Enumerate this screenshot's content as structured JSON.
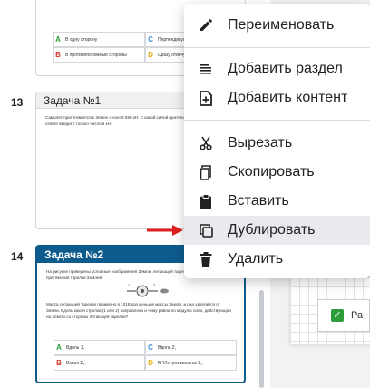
{
  "slides": [
    {
      "number": "",
      "title": "",
      "text": "",
      "options": [
        {
          "letter": "A",
          "text": "В одну сторону",
          "color": "green"
        },
        {
          "letter": "C",
          "text": "Перпендикулярно",
          "color": "blue"
        },
        {
          "letter": "B",
          "text": "В противоположные стороны",
          "color": "red"
        },
        {
          "letter": "D",
          "text": "Сразу отвечу",
          "color": "yellow"
        }
      ]
    },
    {
      "number": "13",
      "title": "Задача №1",
      "text": "Самолёт притягивается к Земле с силой 550 кН. С какой силой притягивается к самолёту? В ответе введите только число в кН."
    },
    {
      "number": "14",
      "title": "Задача №2",
      "text": "На рисунке приведены условные изображения Земли, летающей тарелки и вектора Fₑ силы притяжения тарелки Землей.",
      "text2": "Масса летающей тарелки примерно в 1018 раз меньше массы Земли, и она удаляется от Земли. Вдоль какой стрелки (1 или 2) направлена и чему равна по модулю сила, действующая на Землю со стороны летающей тарелки?",
      "diagram_labels": [
        "1",
        "2"
      ],
      "options": [
        {
          "letter": "A",
          "text": "Вдоль 1,",
          "color": "green"
        },
        {
          "letter": "C",
          "text": "Вдоль 2,",
          "color": "blue"
        },
        {
          "letter": "B",
          "text": "Равна Fₑ,",
          "color": "red"
        },
        {
          "letter": "D",
          "text": "В 10¹⁸ раз меньше Fₑ,",
          "color": "yellow"
        }
      ]
    }
  ],
  "canvas": {
    "row_text": "Ра"
  },
  "menu": {
    "items": [
      {
        "label": "Переименовать",
        "icon": "pencil-icon"
      },
      {
        "label": "Добавить раздел",
        "icon": "section-lines-icon"
      },
      {
        "label": "Добавить контент",
        "icon": "add-content-icon"
      },
      {
        "label": "Вырезать",
        "icon": "scissors-icon"
      },
      {
        "label": "Скопировать",
        "icon": "copy-icon"
      },
      {
        "label": "Вставить",
        "icon": "clipboard-icon"
      },
      {
        "label": "Дублировать",
        "icon": "duplicate-icon",
        "hover": true
      },
      {
        "label": "Удалить",
        "icon": "trash-icon"
      }
    ]
  },
  "colors": {
    "accent": "#0d5b8d",
    "arrow": "#e02020",
    "hover": "#e8eaed"
  }
}
